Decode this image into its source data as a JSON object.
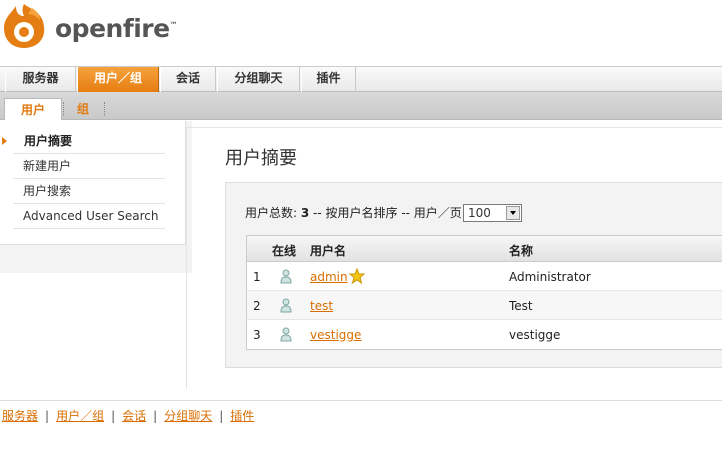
{
  "brand": {
    "name": "openfire",
    "tm": "™",
    "accent": "#e57e12",
    "link_color": "#d96d00"
  },
  "main_tabs": [
    {
      "label": "服务器",
      "active": false
    },
    {
      "label": "用户／组",
      "active": true
    },
    {
      "label": "会话",
      "active": false
    },
    {
      "label": "分组聊天",
      "active": false
    },
    {
      "label": "插件",
      "active": false
    }
  ],
  "sub_tabs": [
    {
      "label": "用户",
      "active": true
    },
    {
      "label": "组",
      "active": false
    }
  ],
  "sidebar": {
    "items": [
      {
        "label": "用户摘要",
        "active": true
      },
      {
        "label": "新建用户",
        "active": false
      },
      {
        "label": "用户搜索",
        "active": false
      },
      {
        "label": "Advanced User Search",
        "active": false
      }
    ]
  },
  "content": {
    "title": "用户摘要",
    "summary_prefix": "用户总数: ",
    "total": "3",
    "summary_suffix": " -- 按用户名排序 -- 用户／页:",
    "per_page": "100",
    "columns": [
      "",
      "在线",
      "用户名",
      "名称"
    ],
    "rows": [
      {
        "index": "1",
        "username": "admin",
        "name": "Administrator",
        "is_admin": true,
        "icon": "offline-user-icon"
      },
      {
        "index": "2",
        "username": "test",
        "name": "Test",
        "is_admin": false,
        "icon": "offline-user-icon"
      },
      {
        "index": "3",
        "username": "vestigge",
        "name": "vestigge",
        "is_admin": false,
        "icon": "offline-user-icon"
      }
    ]
  },
  "footer": {
    "links": [
      "服务器",
      "用户／组",
      "会话",
      "分组聊天",
      "插件"
    ]
  }
}
